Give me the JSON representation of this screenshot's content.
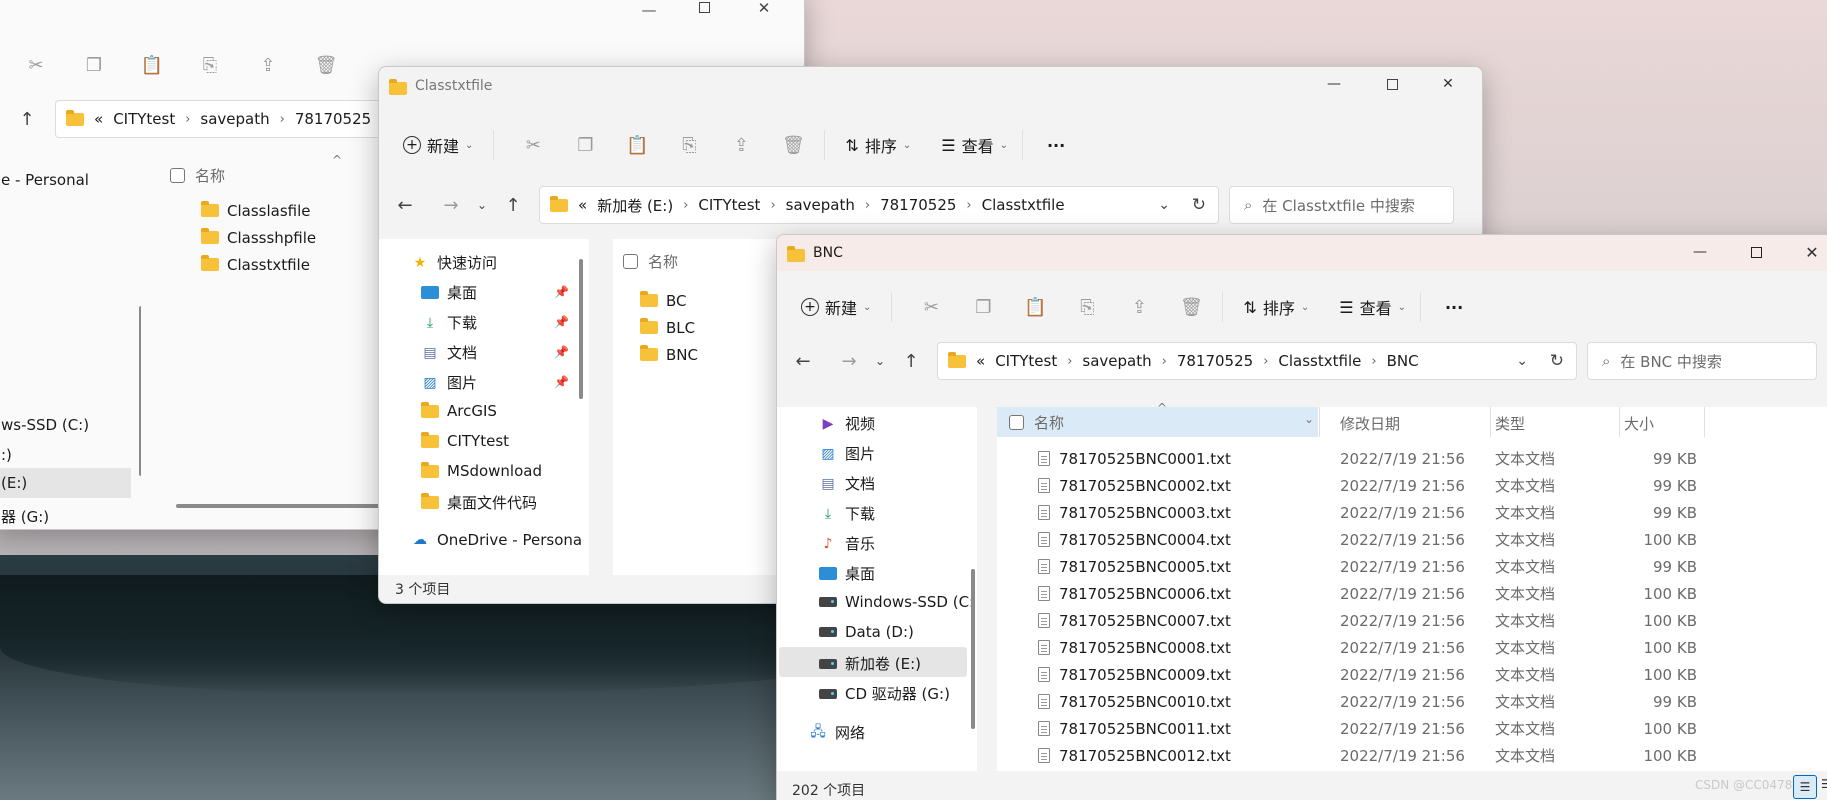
{
  "colors": {
    "folder": "#f8c13a",
    "selected_row": "#e5e5e5",
    "header_selected": "#dbeaf7",
    "accent_blue": "#0067c0"
  },
  "window1": {
    "address": {
      "prefix": "«",
      "crumbs": [
        "CITYtest",
        "savepath",
        "78170525"
      ]
    },
    "nav_items": [
      "e - Personal",
      "ws-SSD (C:)",
      ":)",
      "(E:)",
      "器 (G:)"
    ],
    "column_name": "名称",
    "files": [
      "Classlasfile",
      "Classshpfile",
      "Classtxtfile"
    ]
  },
  "window2": {
    "title": "Classtxtfile",
    "toolbar": {
      "new": "新建",
      "sort": "排序",
      "view": "查看",
      "more": "···"
    },
    "address": {
      "prefix": "«",
      "crumbs": [
        "新加卷 (E:)",
        "CITYtest",
        "savepath",
        "78170525",
        "Classtxtfile"
      ]
    },
    "search_placeholder": "在 Classtxtfile 中搜索",
    "nav_items": [
      {
        "label": "快速访问",
        "icon": "star-icon"
      },
      {
        "label": "桌面",
        "icon": "desktop-icon",
        "pinned": true
      },
      {
        "label": "下载",
        "icon": "download-icon",
        "pinned": true
      },
      {
        "label": "文档",
        "icon": "document-icon",
        "pinned": true
      },
      {
        "label": "图片",
        "icon": "picture-icon",
        "pinned": true
      },
      {
        "label": "ArcGIS",
        "icon": "folder-icon"
      },
      {
        "label": "CITYtest",
        "icon": "folder-icon"
      },
      {
        "label": "MSdownload",
        "icon": "folder-icon"
      },
      {
        "label": "桌面文件代码",
        "icon": "folder-icon"
      },
      {
        "label": "OneDrive - Persona",
        "icon": "cloud-icon"
      }
    ],
    "column_name": "名称",
    "files": [
      "BC",
      "BLC",
      "BNC"
    ],
    "status": "3 个项目"
  },
  "window3": {
    "title": "BNC",
    "toolbar": {
      "new": "新建",
      "sort": "排序",
      "view": "查看",
      "more": "···"
    },
    "address": {
      "prefix": "«",
      "crumbs": [
        "CITYtest",
        "savepath",
        "78170525",
        "Classtxtfile",
        "BNC"
      ]
    },
    "search_placeholder": "在 BNC 中搜索",
    "nav_items": [
      {
        "label": "视频",
        "icon": "video-icon"
      },
      {
        "label": "图片",
        "icon": "picture-icon"
      },
      {
        "label": "文档",
        "icon": "document-icon"
      },
      {
        "label": "下载",
        "icon": "download-icon"
      },
      {
        "label": "音乐",
        "icon": "music-icon"
      },
      {
        "label": "桌面",
        "icon": "desktop-icon"
      },
      {
        "label": "Windows-SSD (C:",
        "icon": "drive-icon"
      },
      {
        "label": "Data (D:)",
        "icon": "drive-icon"
      },
      {
        "label": "新加卷 (E:)",
        "icon": "drive-icon",
        "selected": true
      },
      {
        "label": "CD 驱动器 (G:)",
        "icon": "drive-icon"
      },
      {
        "label": "网络",
        "icon": "network-icon"
      }
    ],
    "columns": {
      "name": "名称",
      "date": "修改日期",
      "type": "类型",
      "size": "大小"
    },
    "files": [
      {
        "name": "78170525BNC0001.txt",
        "date": "2022/7/19 21:56",
        "type": "文本文档",
        "size": "99 KB"
      },
      {
        "name": "78170525BNC0002.txt",
        "date": "2022/7/19 21:56",
        "type": "文本文档",
        "size": "99 KB"
      },
      {
        "name": "78170525BNC0003.txt",
        "date": "2022/7/19 21:56",
        "type": "文本文档",
        "size": "99 KB"
      },
      {
        "name": "78170525BNC0004.txt",
        "date": "2022/7/19 21:56",
        "type": "文本文档",
        "size": "100 KB"
      },
      {
        "name": "78170525BNC0005.txt",
        "date": "2022/7/19 21:56",
        "type": "文本文档",
        "size": "99 KB"
      },
      {
        "name": "78170525BNC0006.txt",
        "date": "2022/7/19 21:56",
        "type": "文本文档",
        "size": "100 KB"
      },
      {
        "name": "78170525BNC0007.txt",
        "date": "2022/7/19 21:56",
        "type": "文本文档",
        "size": "100 KB"
      },
      {
        "name": "78170525BNC0008.txt",
        "date": "2022/7/19 21:56",
        "type": "文本文档",
        "size": "100 KB"
      },
      {
        "name": "78170525BNC0009.txt",
        "date": "2022/7/19 21:56",
        "type": "文本文档",
        "size": "100 KB"
      },
      {
        "name": "78170525BNC0010.txt",
        "date": "2022/7/19 21:56",
        "type": "文本文档",
        "size": "99 KB"
      },
      {
        "name": "78170525BNC0011.txt",
        "date": "2022/7/19 21:56",
        "type": "文本文档",
        "size": "100 KB"
      },
      {
        "name": "78170525BNC0012.txt",
        "date": "2022/7/19 21:56",
        "type": "文本文档",
        "size": "100 KB"
      }
    ],
    "status": "202 个项目"
  },
  "watermark": "CSDN @CC0478"
}
